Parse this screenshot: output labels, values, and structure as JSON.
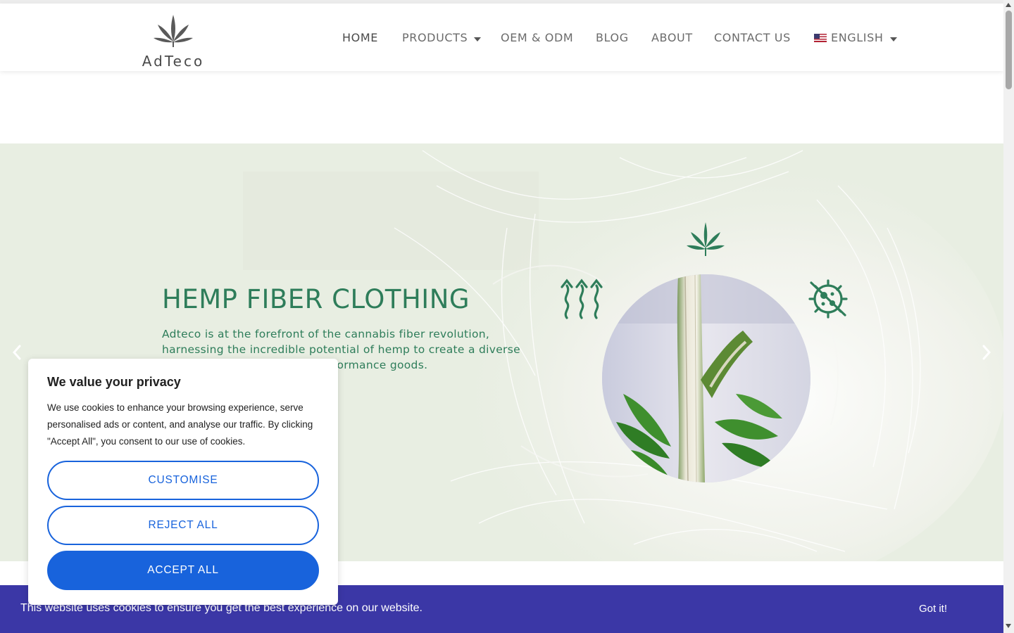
{
  "brand": {
    "logo_text": "AdTeco"
  },
  "nav": {
    "items": [
      {
        "label": "HOME",
        "active": true
      },
      {
        "label": "PRODUCTS",
        "dropdown": true
      },
      {
        "label": "OEM & ODM"
      },
      {
        "label": "BLOG"
      },
      {
        "label": "ABOUT"
      },
      {
        "label": "CONTACT US"
      },
      {
        "label": "ENGLISH",
        "dropdown": true,
        "icon": "us-flag-icon"
      }
    ]
  },
  "hero": {
    "title": "HEMP FIBER CLOTHING",
    "text": "Adteco is at the forefront of the cannabis fiber revolution, harnessing the incredible potential of hemp to create a diverse range of sustainable, high-performance goods.",
    "icons": [
      "cannabis-leaf-icon",
      "breathable-arrows-icon",
      "antibacterial-icon"
    ],
    "accent_color": "#2e7d5a",
    "background_color": "#e8eee2"
  },
  "privacy_popup": {
    "title": "We value your privacy",
    "body": "We use cookies to enhance your browsing experience, serve personalised ads or content, and analyse our traffic. By clicking \"Accept All\", you consent to our use of cookies.",
    "customise_label": "CUSTOMISE",
    "reject_label": "REJECT ALL",
    "accept_label": "ACCEPT ALL",
    "button_color": "#1863dc"
  },
  "cookie_bar": {
    "message": "This website uses cookies to ensure you get the best experience on our website.",
    "button_label": "Got it!",
    "background_color": "#3b37a6"
  }
}
